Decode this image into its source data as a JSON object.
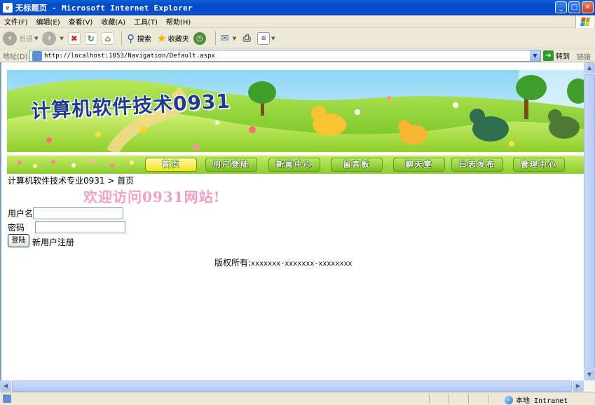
{
  "window": {
    "title": "无标题页 - Microsoft Internet Explorer",
    "buttons": {
      "minimize": "_",
      "maximize": "□",
      "close": "✕"
    }
  },
  "menu": [
    "文件(F)",
    "编辑(E)",
    "查看(V)",
    "收藏(A)",
    "工具(T)",
    "帮助(H)"
  ],
  "toolbar": {
    "back_label": "后退",
    "search_label": "搜索",
    "favorites_label": "收藏夹"
  },
  "address": {
    "label": "地址(D)",
    "url": "http://localhost:1053/Navigation/Default.aspx",
    "go_label": "转到",
    "links_label": "链接"
  },
  "page": {
    "banner_title": "计算机软件技术0931",
    "nav": [
      "首页",
      "用户登陆",
      "新闻中心",
      "留言板",
      "聊天室",
      "日志发布",
      "管理中心"
    ],
    "breadcrumb": "计算机软件技术专业0931 > 首页",
    "welcome": "欢迎访问0931网站!",
    "username_label": "用户名",
    "password_label": "密码",
    "login_button": "登陆",
    "register_link": "新用户注册",
    "copyright_label": "版权所有:",
    "copyright_value": "xxxxxxx-xxxxxxx-xxxxxxxx"
  },
  "status": {
    "zone": "本地 Intranet"
  },
  "colors": {
    "title_bar": "#0348c4",
    "nav_green": "#8acc2c",
    "nav_active": "#f4e21a",
    "welcome_pink": "#f59ec4",
    "banner_title": "#1f3b8d"
  }
}
